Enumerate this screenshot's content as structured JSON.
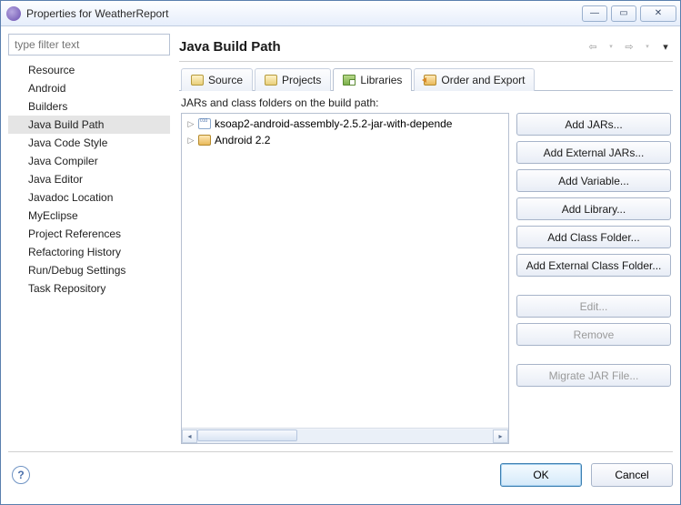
{
  "window": {
    "title": "Properties for WeatherReport",
    "min_glyph": "—",
    "max_glyph": "▭",
    "close_glyph": "✕"
  },
  "filter_placeholder": "type filter text",
  "tree": {
    "items": [
      "Resource",
      "Android",
      "Builders",
      "Java Build Path",
      "Java Code Style",
      "Java Compiler",
      "Java Editor",
      "Javadoc Location",
      "MyEclipse",
      "Project References",
      "Refactoring History",
      "Run/Debug Settings",
      "Task Repository"
    ],
    "selected": "Java Build Path"
  },
  "page": {
    "title": "Java Build Path",
    "nav_back": "⇦",
    "nav_fwd": "⇨",
    "nav_menu": "▾"
  },
  "tabs": {
    "items": [
      {
        "id": "source",
        "label": "Source",
        "icon": "folder"
      },
      {
        "id": "projects",
        "label": "Projects",
        "icon": "folder"
      },
      {
        "id": "libraries",
        "label": "Libraries",
        "icon": "lib"
      },
      {
        "id": "order",
        "label": "Order and Export",
        "icon": "export"
      }
    ],
    "active": "libraries"
  },
  "libraries": {
    "caption": "JARs and class folders on the build path:",
    "entries": [
      {
        "icon": "jar",
        "label": "ksoap2-android-assembly-2.5.2-jar-with-depende"
      },
      {
        "icon": "android",
        "label": "Android 2.2"
      }
    ]
  },
  "buttons": {
    "add_jars": "Add JARs...",
    "add_ext_jars": "Add External JARs...",
    "add_variable": "Add Variable...",
    "add_library": "Add Library...",
    "add_class_folder": "Add Class Folder...",
    "add_ext_class_folder": "Add External Class Folder...",
    "edit": "Edit...",
    "remove": "Remove",
    "migrate": "Migrate JAR File..."
  },
  "footer": {
    "help": "?",
    "ok": "OK",
    "cancel": "Cancel"
  }
}
